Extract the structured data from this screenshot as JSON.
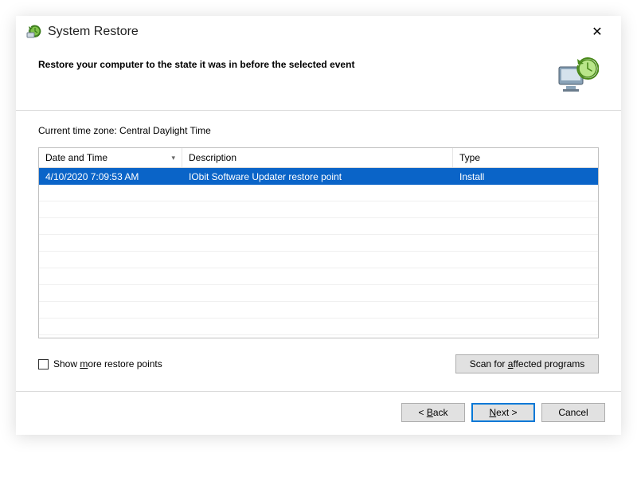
{
  "window": {
    "title": "System Restore",
    "close_glyph": "✕"
  },
  "header": {
    "heading": "Restore your computer to the state it was in before the selected event"
  },
  "timezone_line": "Current time zone: Central Daylight Time",
  "grid": {
    "columns": {
      "date_time": "Date and Time",
      "description": "Description",
      "type": "Type"
    },
    "rows": [
      {
        "date_time": "4/10/2020 7:09:53 AM",
        "description": "IObit Software Updater restore point",
        "type": "Install",
        "selected": true
      }
    ]
  },
  "options": {
    "show_more_label_pre": "Show ",
    "show_more_label_accel": "m",
    "show_more_label_post": "ore restore points",
    "show_more_checked": false
  },
  "buttons": {
    "scan_pre": "Scan for ",
    "scan_accel": "a",
    "scan_post": "ffected programs",
    "back_pre": "< ",
    "back_accel": "B",
    "back_post": "ack",
    "next_accel": "N",
    "next_post": "ext >",
    "cancel": "Cancel"
  }
}
